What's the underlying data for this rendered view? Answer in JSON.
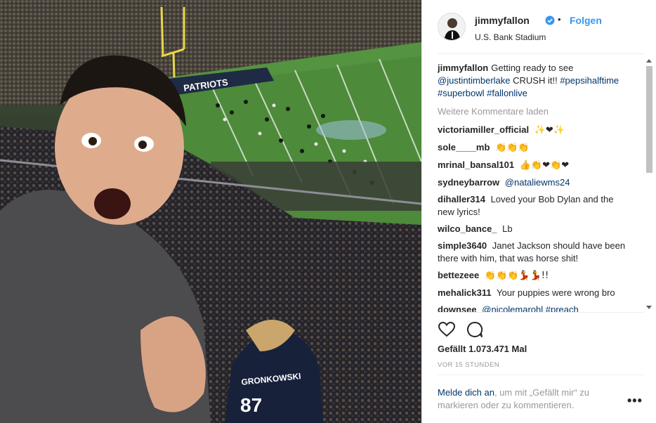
{
  "post": {
    "username": "jimmyfallon",
    "separator": "•",
    "follow_label": "Folgen",
    "location": "U.S. Bank Stadium"
  },
  "caption": {
    "user": "jimmyfallon",
    "text_1": "Getting ready to see",
    "mention": "@justintimberlake",
    "text_2": "CRUSH it!!",
    "hashtags": "#pepsihalftime #superbowl #fallonlive"
  },
  "load_more_label": "Weitere Kommentare laden",
  "comments": [
    {
      "user": "victoriamiller_official",
      "text": "✨❤✨"
    },
    {
      "user": "sole____mb",
      "text": "👏👏👏"
    },
    {
      "user": "mrinal_bansal101",
      "text": "👍👏❤👏❤"
    },
    {
      "user": "sydneybarrow",
      "text": "@nataliewms24"
    },
    {
      "user": "dihaller314",
      "text": "Loved your Bob Dylan and the new lyrics!"
    },
    {
      "user": "wilco_bance_",
      "text": "Lb"
    },
    {
      "user": "simple3640",
      "text": "Janet Jackson should have been there with him, that was horse shit!"
    },
    {
      "user": "bettezeee",
      "text": "👏👏👏💃💃!!"
    },
    {
      "user": "mehalick311",
      "text": "Your puppies were wrong bro"
    },
    {
      "user": "downsee",
      "text": "@nicolemarohl #preach"
    }
  ],
  "likes": "Gefällt 1.073.471 Mal",
  "timestamp": "VOR 15 STUNDEN",
  "login": {
    "link": "Melde dich an",
    "text": ", um mit „Gefällt mir“ zu markieren oder zu kommentieren."
  },
  "photo_text": {
    "jersey_name": "GRONKOWSKI",
    "jersey_number": "87",
    "field_text": "PATRIOTS"
  },
  "colors": {
    "link": "#003569",
    "follow": "#3897f0",
    "verified": "#3897f0",
    "muted": "#999999"
  },
  "icons": [
    "heart-icon",
    "comment-icon",
    "verified-icon",
    "more-icon"
  ]
}
